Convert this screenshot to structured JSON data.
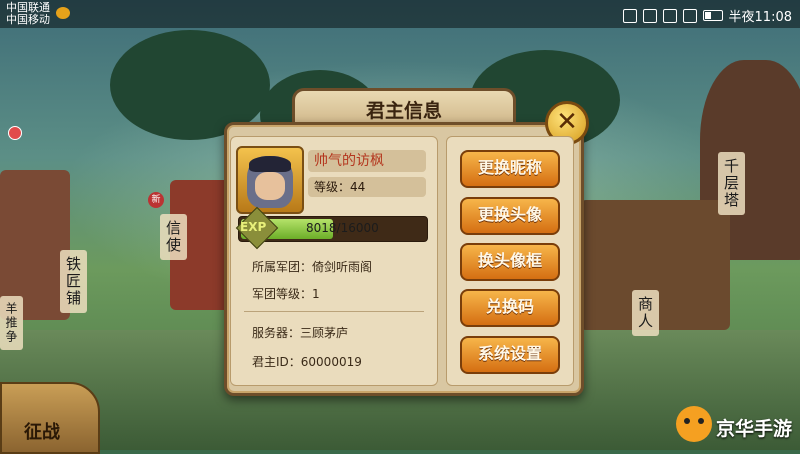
{
  "status_bar": {
    "carrier1": "中国联通",
    "carrier2": "中国移动",
    "time": "半夜11:08",
    "icons": [
      "notification-icon",
      "hd-icon",
      "signal-2g-icon",
      "signal-4g-icon",
      "battery-icon"
    ]
  },
  "scene": {
    "left_sign": "铁匠铺",
    "mid_sign": "信使",
    "right_sign_top": "千层塔",
    "right_sign_bottom": "商人",
    "new_badge": "新",
    "war_button": "征战",
    "left_side_text": "羊推争",
    "watermark": "京华手游"
  },
  "dialog": {
    "title": "君主信息",
    "close_icon": "close-x-icon",
    "player": {
      "name": "帅气的访枫",
      "level_label": "等级：44",
      "exp_label": "EXP",
      "exp_text": "8018/16000",
      "exp_current": 8018,
      "exp_max": 16000
    },
    "info": {
      "legion": "所属军团：倚剑听雨阁",
      "legion_level": "军团等级：1",
      "server": "服务器：三顾茅庐",
      "lord_id": "君主ID：60000019"
    },
    "buttons": [
      "更换昵称",
      "更换头像",
      "换头像框",
      "兑换码",
      "系统设置"
    ]
  },
  "colors": {
    "accent_orange": "#e0821f",
    "panel_bg": "#eadcbd",
    "exp_green": "#8cc43a",
    "name_red": "#b4361e"
  }
}
